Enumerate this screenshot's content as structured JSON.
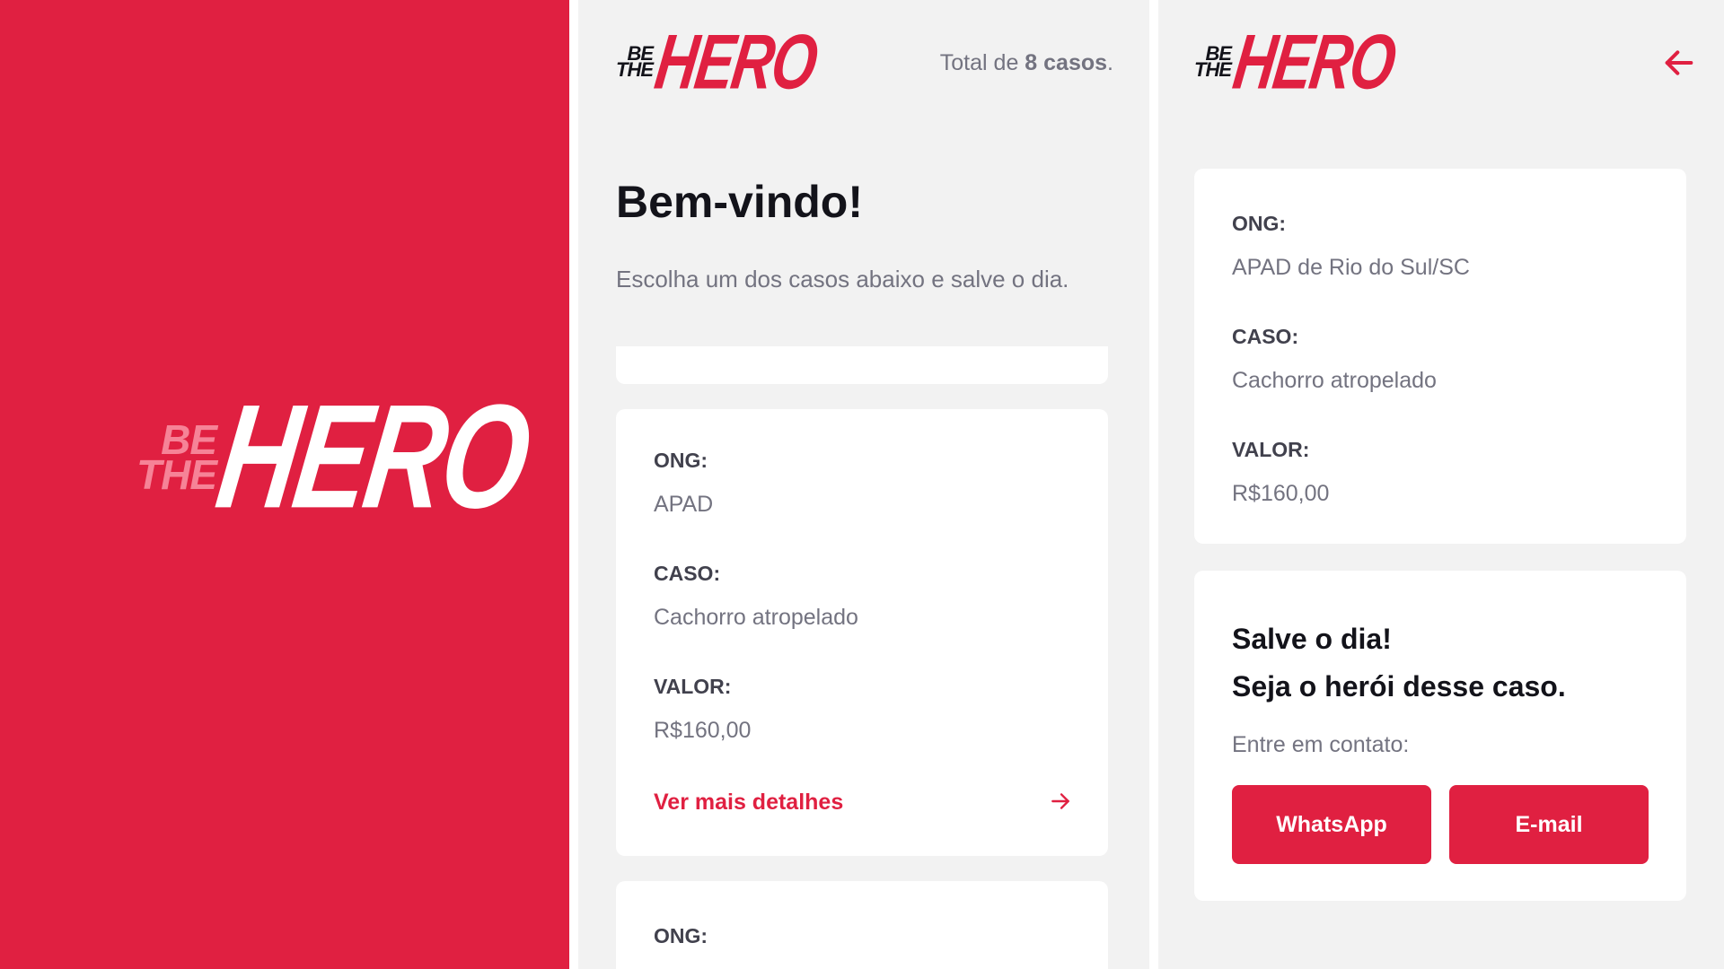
{
  "brand": {
    "line1": "BE",
    "line2": "THE",
    "main": "HERO",
    "primary_color": "#E02041",
    "light_color": "#F68397",
    "background_color": "#F2F2F2"
  },
  "list_screen": {
    "total_prefix": "Total de ",
    "total_count": "8 casos",
    "total_suffix": ".",
    "title": "Bem-vindo!",
    "subtitle": "Escolha um dos casos abaixo e salve o dia.",
    "incidents": [
      {
        "ong_label": "ONG:",
        "ong_value": "APAD",
        "case_label": "CASO:",
        "case_value": "Cachorro atropelado",
        "value_label": "VALOR:",
        "value_value": "R$160,00",
        "details_link": "Ver mais detalhes"
      },
      {
        "ong_label": "ONG:"
      }
    ]
  },
  "detail_screen": {
    "back_icon": "arrow-left-icon",
    "incident": {
      "ong_label": "ONG:",
      "ong_value": "APAD de Rio do Sul/SC",
      "case_label": "CASO:",
      "case_value": "Cachorro atropelado",
      "value_label": "VALOR:",
      "value_value": "R$160,00"
    },
    "contact": {
      "title_line1": "Salve o dia!",
      "title_line2": "Seja o herói desse caso.",
      "label": "Entre em contato:",
      "whatsapp_button": "WhatsApp",
      "email_button": "E-mail"
    }
  }
}
